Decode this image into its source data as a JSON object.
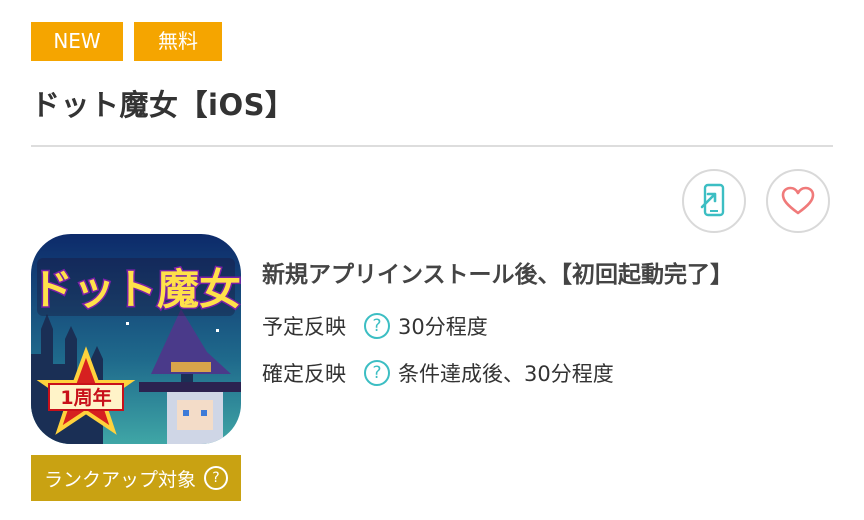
{
  "badges": {
    "new": "NEW",
    "free": "無料"
  },
  "title": "ドット魔女【iOS】",
  "app_icon": {
    "title_text": "ドット魔女",
    "anniversary_text": "1周年"
  },
  "rank_badge": {
    "label": "ランクアップ対象",
    "help_icon": "?"
  },
  "condition": "新規アプリインストール後、【初回起動完了】",
  "rows": [
    {
      "label": "予定反映",
      "help_icon": "?",
      "value": "30分程度"
    },
    {
      "label": "確定反映",
      "help_icon": "?",
      "value": "条件達成後、30分程度"
    }
  ],
  "actions": {
    "phone_icon": "smartphone-arrow-icon",
    "heart_icon": "heart-outline-icon"
  },
  "colors": {
    "badge": "#f5a500",
    "rank": "#c9a212",
    "accent": "#3cbec3",
    "heart": "#f07a7a"
  }
}
